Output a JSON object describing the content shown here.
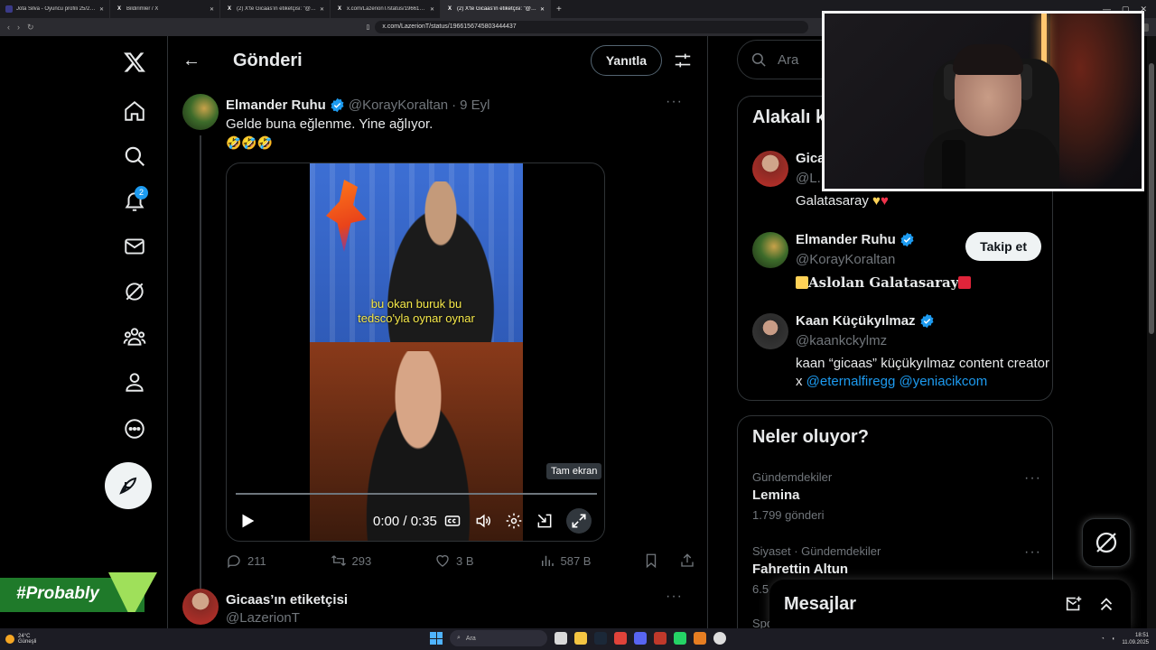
{
  "browser": {
    "tabs": [
      {
        "label": "Jota Silva - Oyuncu profili 25/26 | Tra",
        "active": false
      },
      {
        "label": "Bildirimler / X",
        "active": false
      },
      {
        "label": "(2) X'te Gicaas'ın etiketçisi: \"@burhan",
        "active": false
      },
      {
        "label": "x.com/LazerionT/status/196615671245",
        "active": false
      },
      {
        "label": "(2) X'te Gicaas'ın etiketçisi: \"@Bu",
        "active": true
      }
    ],
    "close_glyph": "✕",
    "new_tab": "+",
    "url": "x.com/LazerionT/status/1966156745803444437"
  },
  "sidebar": {
    "logo": "X",
    "items": [
      {
        "icon": "home-icon"
      },
      {
        "icon": "search-icon"
      },
      {
        "icon": "bell-icon",
        "badge": "2"
      },
      {
        "icon": "mail-icon"
      },
      {
        "icon": "grok-icon"
      },
      {
        "icon": "communities-icon"
      },
      {
        "icon": "profile-icon"
      },
      {
        "icon": "more-icon"
      }
    ]
  },
  "header": {
    "back": "←",
    "title": "Gönderi",
    "reply_button": "Yanıtla"
  },
  "tweet": {
    "name": "Elmander Ruhu",
    "handle": "@KorayKoraltan",
    "dot": "·",
    "date": "9 Eyl",
    "more": "···",
    "text": "Gelde buna eğlenme. Yine ağlıyor.",
    "emojis": "🤣🤣🤣",
    "video": {
      "caption_line1": "bu okan buruk bu",
      "caption_line2": "tedsco'yla oynar oynar",
      "tooltip": "Tam ekran",
      "time": "0:00 / 0:35"
    },
    "stats": {
      "replies": "211",
      "reposts": "293",
      "likes": "3 B",
      "views": "587 B"
    }
  },
  "reply": {
    "name": "Gicaas’ın etiketçisi",
    "handle": "@LazerionT",
    "more": "···"
  },
  "right": {
    "search_placeholder": "Ara",
    "related": {
      "title": "Alakalı kişiler",
      "people": [
        {
          "name": "Gicaas",
          "handle": "@L...",
          "bio_text": "Galatasaray",
          "verified": false
        },
        {
          "name": "Elmander Ruhu",
          "handle": "@KorayKoraltan",
          "bio_text": "Aslolan Galatasaray",
          "follow": "Takip et",
          "verified": true
        },
        {
          "name": "Kaan Küçükyılmaz",
          "handle": "@kaankckylmz",
          "bio_text": "kaan “gicaas” küçükyılmaz content creator x",
          "bio_links": [
            "@eternalfiregg",
            "@yeniacikcom"
          ],
          "verified": true
        }
      ]
    },
    "trends": {
      "title": "Neler oluyor?",
      "items": [
        {
          "category": "Gündemdekiler",
          "name": "Lemina",
          "count": "1.799 gönderi"
        },
        {
          "category": "Siyaset · Gündemdekiler",
          "name": "Fahrettin Altun",
          "count": "6.5..."
        },
        {
          "category": "Spo...",
          "name": "",
          "count": ""
        }
      ],
      "more": "···"
    }
  },
  "messages": {
    "title": "Mesajlar"
  },
  "overlay": {
    "streamer_tag": "#Probably"
  },
  "taskbar": {
    "weather_temp": "24°C",
    "weather_text": "Güneşli",
    "search": "Ara",
    "time": "18:51",
    "date": "11.09.2025"
  },
  "colors": {
    "accent": "#1d9bf0",
    "background": "#000000",
    "border": "#2f3336",
    "streamer_green": "#1f7a2a"
  }
}
